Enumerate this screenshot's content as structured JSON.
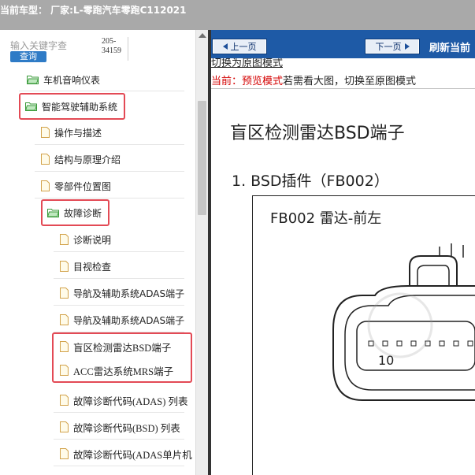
{
  "topbar": {
    "text": "当前车型：  厂家:L-零跑汽车零跑C112021"
  },
  "sidebar": {
    "search_placeholder": "输入关键字查",
    "search_button": "查询",
    "count_line1": "205-",
    "count_line2": "34159",
    "items": [
      {
        "label": "车机音响仪表",
        "type": "folder"
      },
      {
        "label": "智能驾驶辅助系统",
        "type": "folder"
      },
      {
        "label": "操作与描述",
        "type": "doc"
      },
      {
        "label": "结构与原理介绍",
        "type": "doc"
      },
      {
        "label": "零部件位置图",
        "type": "doc"
      },
      {
        "label": "故障诊断",
        "type": "folder"
      },
      {
        "label": "诊断说明",
        "type": "doc"
      },
      {
        "label": "目视检查",
        "type": "doc"
      },
      {
        "label": "导航及辅助系统ADAS端子",
        "type": "doc"
      },
      {
        "label": "导航及辅助系统ADAS端子",
        "type": "doc"
      },
      {
        "label": "盲区检测雷达BSD端子",
        "type": "doc"
      },
      {
        "label": "ACC雷达系统MRS端子",
        "type": "doc"
      },
      {
        "label": "故障诊断代码(ADAS) 列表",
        "type": "doc"
      },
      {
        "label": "故障诊断代码(BSD) 列表",
        "type": "doc"
      },
      {
        "label": "故障诊断代码(ADAS单片机",
        "type": "doc"
      }
    ]
  },
  "header": {
    "prev_label": "上一页",
    "next_label": "下一页",
    "refresh_label": "刷新当前"
  },
  "mode": {
    "toggle_link": "切换为原图模式",
    "current_prefix": "当前：",
    "current_mode": "预览模式",
    "hint": "若需看大图，切换至原图模式"
  },
  "document": {
    "title": "盲区检测雷达BSD端子",
    "section": "1. BSD插件（FB002）",
    "connector_label": "FB002  雷达-前左",
    "pin_number": "10"
  },
  "colors": {
    "topbar": "#a9a9a9",
    "header": "#1e5aa6",
    "highlight": "#e34a55",
    "search_button": "#2e7bc6",
    "mode_red": "#d40000"
  }
}
